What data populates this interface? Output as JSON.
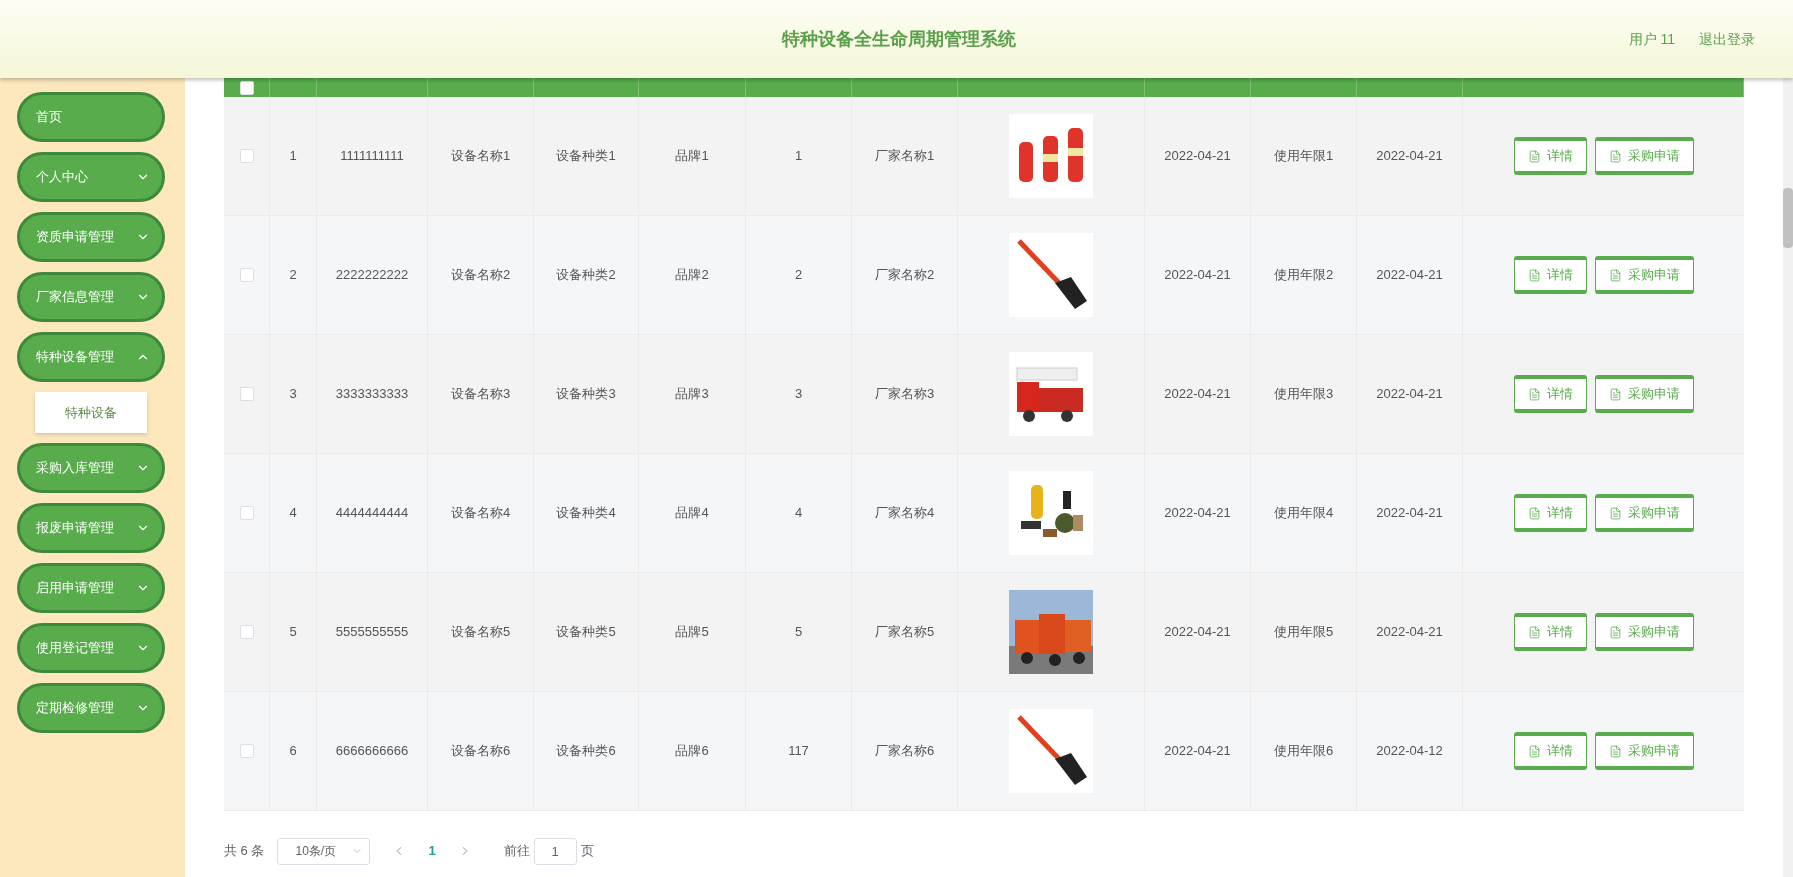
{
  "header": {
    "title": "特种设备全生命周期管理系统",
    "user": "用户 11",
    "logout": "退出登录"
  },
  "sidebar": {
    "items": [
      {
        "label": "首页",
        "kind": "link"
      },
      {
        "label": "个人中心",
        "kind": "menu",
        "expanded": false
      },
      {
        "label": "资质申请管理",
        "kind": "menu",
        "expanded": false
      },
      {
        "label": "厂家信息管理",
        "kind": "menu",
        "expanded": false
      },
      {
        "label": "特种设备管理",
        "kind": "menu",
        "expanded": true,
        "children": [
          {
            "label": "特种设备"
          }
        ]
      },
      {
        "label": "采购入库管理",
        "kind": "menu",
        "expanded": false
      },
      {
        "label": "报废申请管理",
        "kind": "menu",
        "expanded": false
      },
      {
        "label": "启用申请管理",
        "kind": "menu",
        "expanded": false
      },
      {
        "label": "使用登记管理",
        "kind": "menu",
        "expanded": false
      },
      {
        "label": "定期检修管理",
        "kind": "menu",
        "expanded": false
      }
    ]
  },
  "table": {
    "header_checked": false,
    "rows": [
      {
        "checked": false,
        "index": "1",
        "code": "1111111111",
        "name": "设备名称1",
        "type": "设备种类1",
        "brand": "品牌1",
        "qty": "1",
        "maker": "厂家名称1",
        "produced": "2022-04-21",
        "life": "使用年限1",
        "expires": "2022-04-21",
        "actions": [
          "详情",
          "采购申请"
        ]
      },
      {
        "checked": false,
        "index": "2",
        "code": "2222222222",
        "name": "设备名称2",
        "type": "设备种类2",
        "brand": "品牌2",
        "qty": "2",
        "maker": "厂家名称2",
        "produced": "2022-04-21",
        "life": "使用年限2",
        "expires": "2022-04-21",
        "actions": [
          "详情",
          "采购申请"
        ]
      },
      {
        "checked": false,
        "index": "3",
        "code": "3333333333",
        "name": "设备名称3",
        "type": "设备种类3",
        "brand": "品牌3",
        "qty": "3",
        "maker": "厂家名称3",
        "produced": "2022-04-21",
        "life": "使用年限3",
        "expires": "2022-04-21",
        "actions": [
          "详情",
          "采购申请"
        ]
      },
      {
        "checked": false,
        "index": "4",
        "code": "4444444444",
        "name": "设备名称4",
        "type": "设备种类4",
        "brand": "品牌4",
        "qty": "4",
        "maker": "厂家名称4",
        "produced": "2022-04-21",
        "life": "使用年限4",
        "expires": "2022-04-21",
        "actions": [
          "详情",
          "采购申请"
        ]
      },
      {
        "checked": false,
        "index": "5",
        "code": "5555555555",
        "name": "设备名称5",
        "type": "设备种类5",
        "brand": "品牌5",
        "qty": "5",
        "maker": "厂家名称5",
        "produced": "2022-04-21",
        "life": "使用年限5",
        "expires": "2022-04-21",
        "actions": [
          "详情",
          "采购申请"
        ]
      },
      {
        "checked": false,
        "index": "6",
        "code": "6666666666",
        "name": "设备名称6",
        "type": "设备种类6",
        "brand": "品牌6",
        "qty": "117",
        "maker": "厂家名称6",
        "produced": "2022-04-21",
        "life": "使用年限6",
        "expires": "2022-04-12",
        "actions": [
          "详情",
          "采购申请"
        ]
      }
    ]
  },
  "pagination": {
    "total": "共 6 条",
    "page_size": "10条/页",
    "pages": [
      {
        "label": "1",
        "selected": true
      }
    ],
    "goto_label": "前往",
    "goto_value": "1",
    "goto_suffix": "页"
  }
}
